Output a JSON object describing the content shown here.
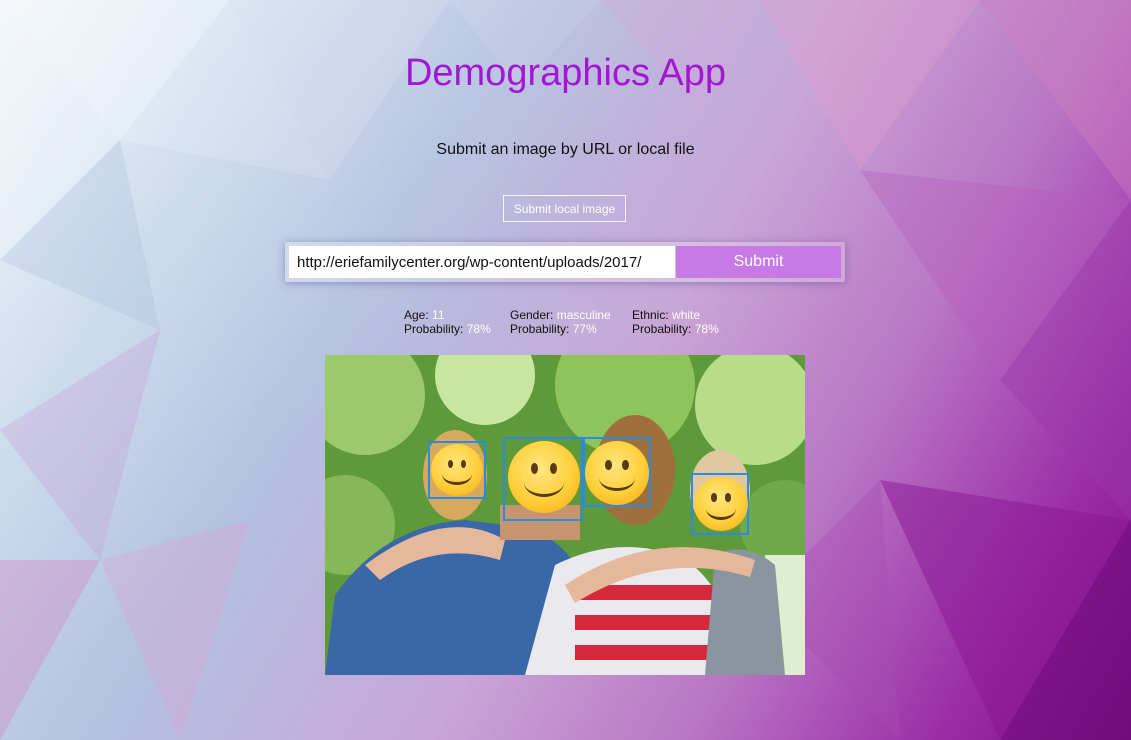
{
  "app": {
    "title": "Demographics App",
    "subtitle": "Submit an image by URL or local file"
  },
  "controls": {
    "local_button_label": "Submit local image",
    "url_value": "http://eriefamilycenter.org/wp-content/uploads/2017/",
    "submit_label": "Submit"
  },
  "results": {
    "age_label": "Age:",
    "age_value": "11",
    "age_prob_label": "Probability:",
    "age_prob_value": "78%",
    "gender_label": "Gender:",
    "gender_value": "masculine",
    "gender_prob_label": "Probability:",
    "gender_prob_value": "77%",
    "ethnic_label": "Ethnic:",
    "ethnic_value": "white",
    "ethnic_prob_label": "Probability:",
    "ethnic_prob_value": "78%"
  },
  "photo": {
    "subject": "family of four outdoors with faces covered by smiley emojis",
    "faces_detected": 4
  },
  "colors": {
    "title": "#a317d4",
    "submit_button": "#c77ae6",
    "face_box": "#2a8be0"
  }
}
